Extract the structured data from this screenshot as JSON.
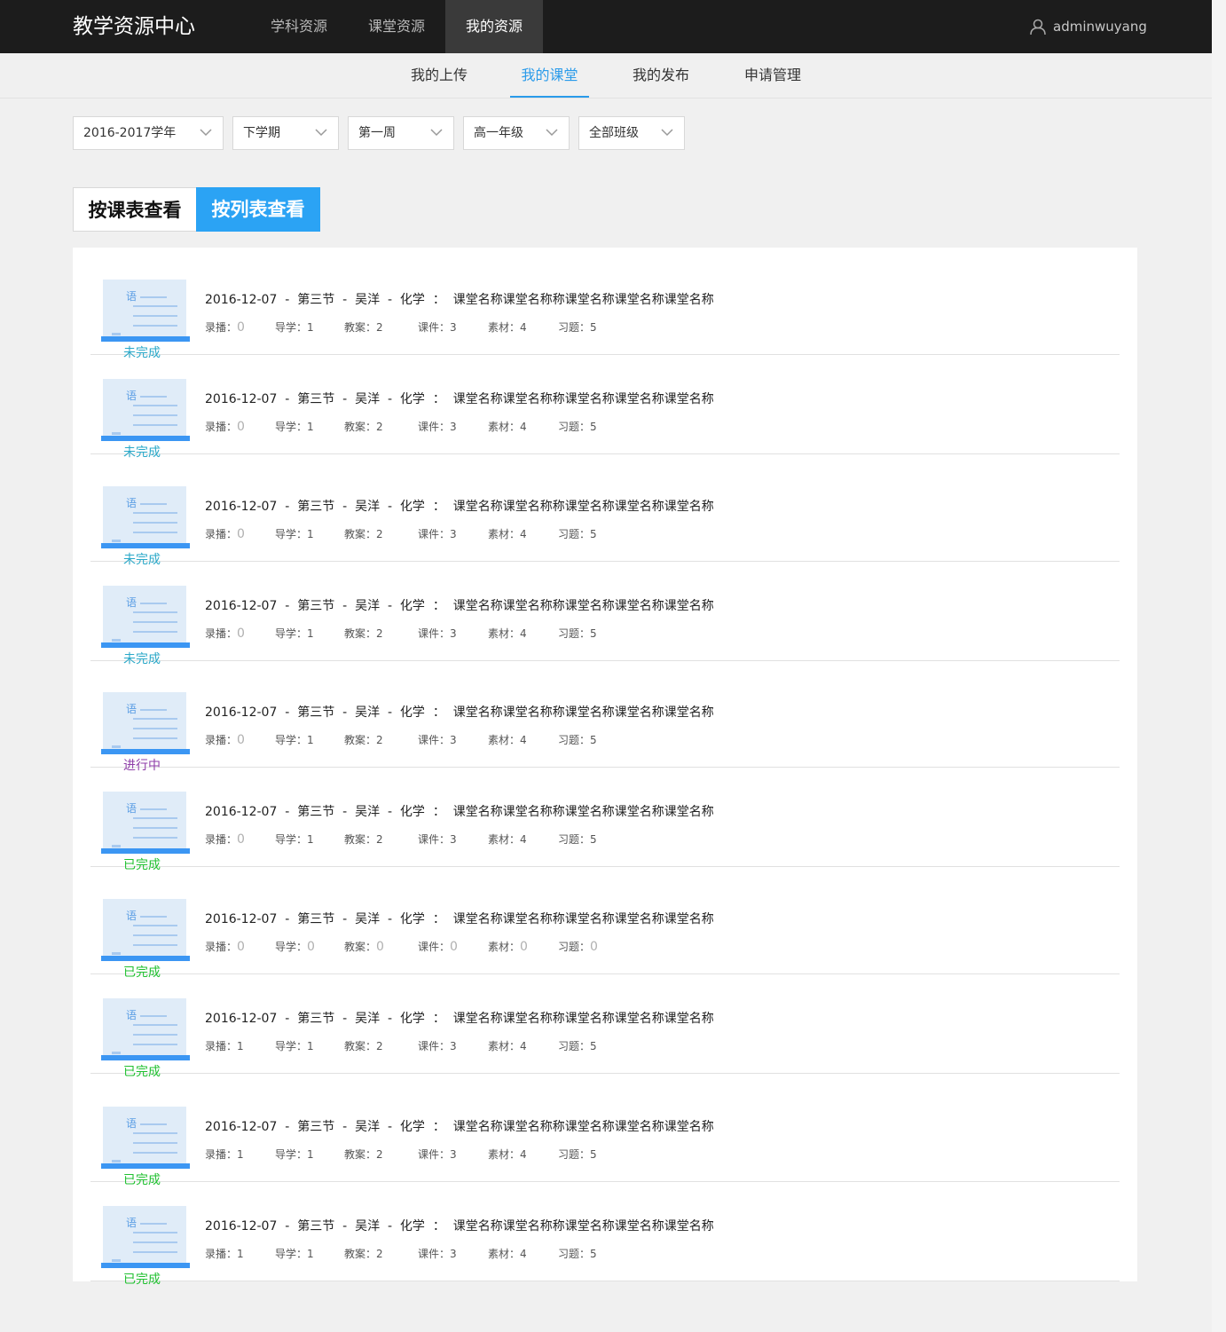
{
  "app": {
    "brand": "教学资源中心",
    "main_nav": [
      "学科资源",
      "课堂资源",
      "我的资源"
    ],
    "active_main": 2,
    "username": "adminwuyang"
  },
  "sub_nav": {
    "items": [
      "我的上传",
      "我的课堂",
      "我的发布",
      "申请管理"
    ],
    "active": 1
  },
  "filters": [
    "2016-2017学年",
    "下学期",
    "第一周",
    "高一年级",
    "全部班级"
  ],
  "view_tabs": [
    "按课表查看",
    "按列表查看"
  ],
  "active_view": 1,
  "stat_labels": [
    "录播：",
    "导学：",
    "教案：",
    "课件：",
    "素材：",
    "习题："
  ],
  "status_colors": {
    "未完成": "#2aa8c8",
    "进行中": "#8e3ea8",
    "已完成": "#20c030"
  },
  "thumb_char": "语",
  "rows": [
    {
      "title": "2016-12-07  -  第三节  -  吴洋  -  化学  ：  课堂名称课堂名称称课堂名称课堂名称课堂名称",
      "status": "未完成",
      "stats": [
        "0",
        "1",
        "2",
        "3",
        "4",
        "5"
      ]
    },
    {
      "title": "2016-12-07  -  第三节  -  吴洋  -  化学  ：  课堂名称课堂名称称课堂名称课堂名称课堂名称",
      "status": "未完成",
      "stats": [
        "0",
        "1",
        "2",
        "3",
        "4",
        "5"
      ]
    },
    {
      "title": "2016-12-07  -  第三节  -  吴洋  -  化学  ：  课堂名称课堂名称称课堂名称课堂名称课堂名称",
      "status": "未完成",
      "stats": [
        "0",
        "1",
        "2",
        "3",
        "4",
        "5"
      ]
    },
    {
      "title": "2016-12-07  -  第三节  -  吴洋  -  化学  ：  课堂名称课堂名称称课堂名称课堂名称课堂名称",
      "status": "未完成",
      "stats": [
        "0",
        "1",
        "2",
        "3",
        "4",
        "5"
      ]
    },
    {
      "title": "2016-12-07  -  第三节  -  吴洋  -  化学  ：  课堂名称课堂名称称课堂名称课堂名称课堂名称",
      "status": "进行中",
      "stats": [
        "0",
        "1",
        "2",
        "3",
        "4",
        "5"
      ]
    },
    {
      "title": "2016-12-07  -  第三节  -  吴洋  -  化学  ：  课堂名称课堂名称称课堂名称课堂名称课堂名称",
      "status": "已完成",
      "stats": [
        "0",
        "1",
        "2",
        "3",
        "4",
        "5"
      ]
    },
    {
      "title": "2016-12-07  -  第三节  -  吴洋  -  化学  ：  课堂名称课堂名称称课堂名称课堂名称课堂名称",
      "status": "已完成",
      "stats": [
        "0",
        "0",
        "0",
        "0",
        "0",
        "0"
      ]
    },
    {
      "title": "2016-12-07  -  第三节  -  吴洋  -  化学  ：  课堂名称课堂名称称课堂名称课堂名称课堂名称",
      "status": "已完成",
      "stats": [
        "1",
        "1",
        "2",
        "3",
        "4",
        "5"
      ]
    },
    {
      "title": "2016-12-07  -  第三节  -  吴洋  -  化学  ：  课堂名称课堂名称称课堂名称课堂名称课堂名称",
      "status": "已完成",
      "stats": [
        "1",
        "1",
        "2",
        "3",
        "4",
        "5"
      ]
    },
    {
      "title": "2016-12-07  -  第三节  -  吴洋  -  化学  ：  课堂名称课堂名称称课堂名称课堂名称课堂名称",
      "status": "已完成",
      "stats": [
        "1",
        "1",
        "2",
        "3",
        "4",
        "5"
      ]
    }
  ]
}
